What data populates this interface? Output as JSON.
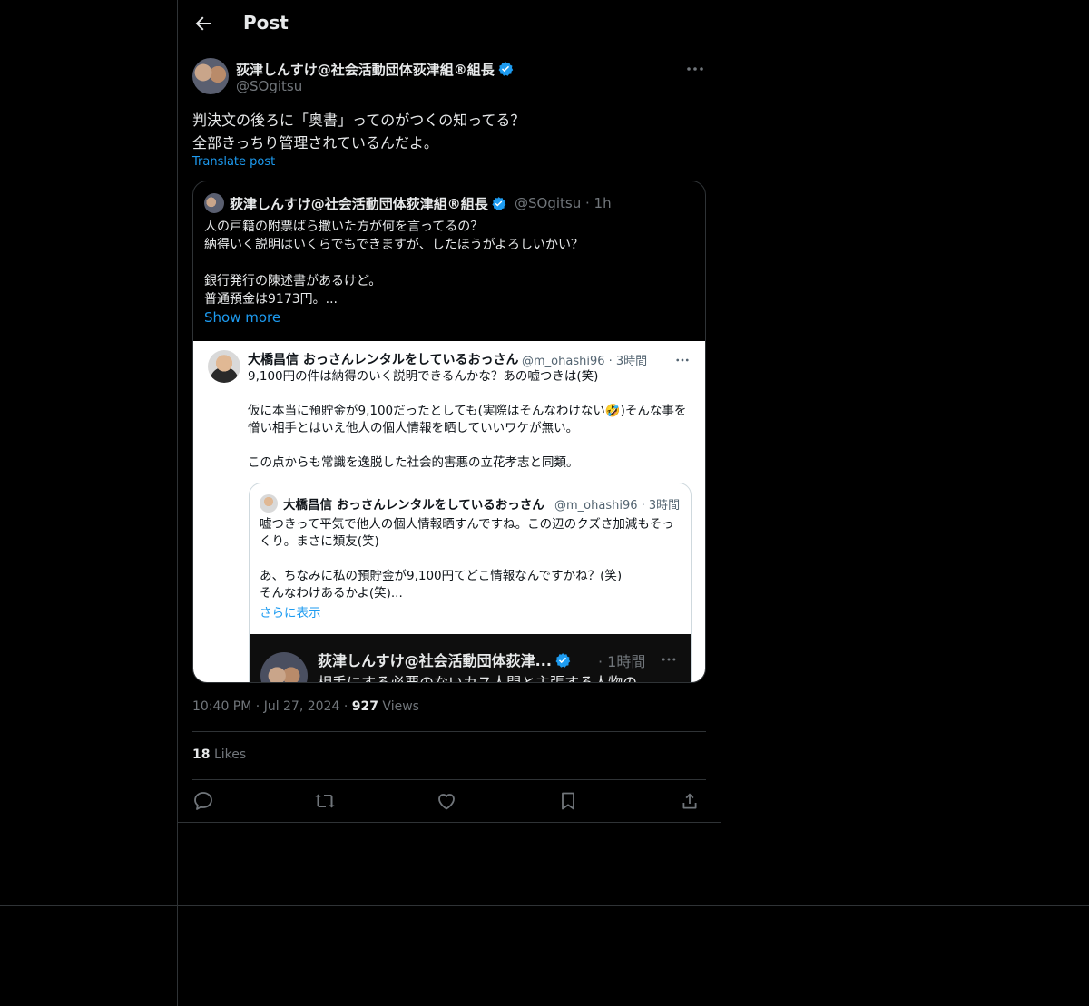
{
  "header": {
    "title": "Post"
  },
  "post": {
    "author_name": "荻津しんすけ@社会活動団体荻津組®組長",
    "author_handle": "@SOgitsu",
    "text_line1": "判決文の後ろに「奥書」ってのがつくの知ってる？",
    "text_line2": "全部きっちり管理されているんだよ。",
    "translate_label": "Translate post",
    "time": "10:40 PM",
    "date": "Jul 27, 2024",
    "views_count": "927",
    "views_label": "Views",
    "likes_count": "18",
    "likes_label": "Likes"
  },
  "quote": {
    "author_name": "荻津しんすけ@社会活動団体荻津組®組長",
    "author_handle": "@SOgitsu",
    "time": "1h",
    "line1": "人の戸籍の附票ばら撒いた方が何を言ってるの？",
    "line2": "納得いく説明はいくらでもできますが、したほうがよろしいかい？",
    "line3": "銀行発行の陳述書があるけど。",
    "line4": "普通預金は9173円。...",
    "show_more": "Show more"
  },
  "screenshot": {
    "author_name": "大橋昌信 おっさんレンタルをしているおっさん",
    "author_meta": "@m_ohashi96 · 3時間",
    "line1": "9,100円の件は納得のいく説明できるんかな？あの嘘つきは(笑)",
    "line2": "仮に本当に預貯金が9,100だったとしても(実際はそんなわけない🤣)そんな事を憎い相手とはいえ他人の個人情報を晒していいワケが無い。",
    "line3": "この点からも常識を逸脱した社会的害悪の立花孝志と同類。",
    "inner": {
      "author_name": "大橋昌信 おっさんレンタルをしているおっさん",
      "author_meta": "@m_ohashi96 · 3時間",
      "line1": "嘘つきって平気で他人の個人情報晒すんですね。この辺のクズさ加減もそっくり。まさに類友(笑)",
      "line2": "あ、ちなみに私の預貯金が9,100円てどこ情報なんですかね？(笑)",
      "line3": "そんなわけあるかよ(笑)...",
      "show_more": "さらに表示",
      "nested": {
        "author_name": "荻津しんすけ@社会活動団体荻津...",
        "time": "· 1時間",
        "text": "相手にする必要のないカス人間と主張する人物の"
      }
    }
  },
  "colors": {
    "accent": "#1d9bf0",
    "background": "#000000",
    "border": "#2f3336"
  }
}
